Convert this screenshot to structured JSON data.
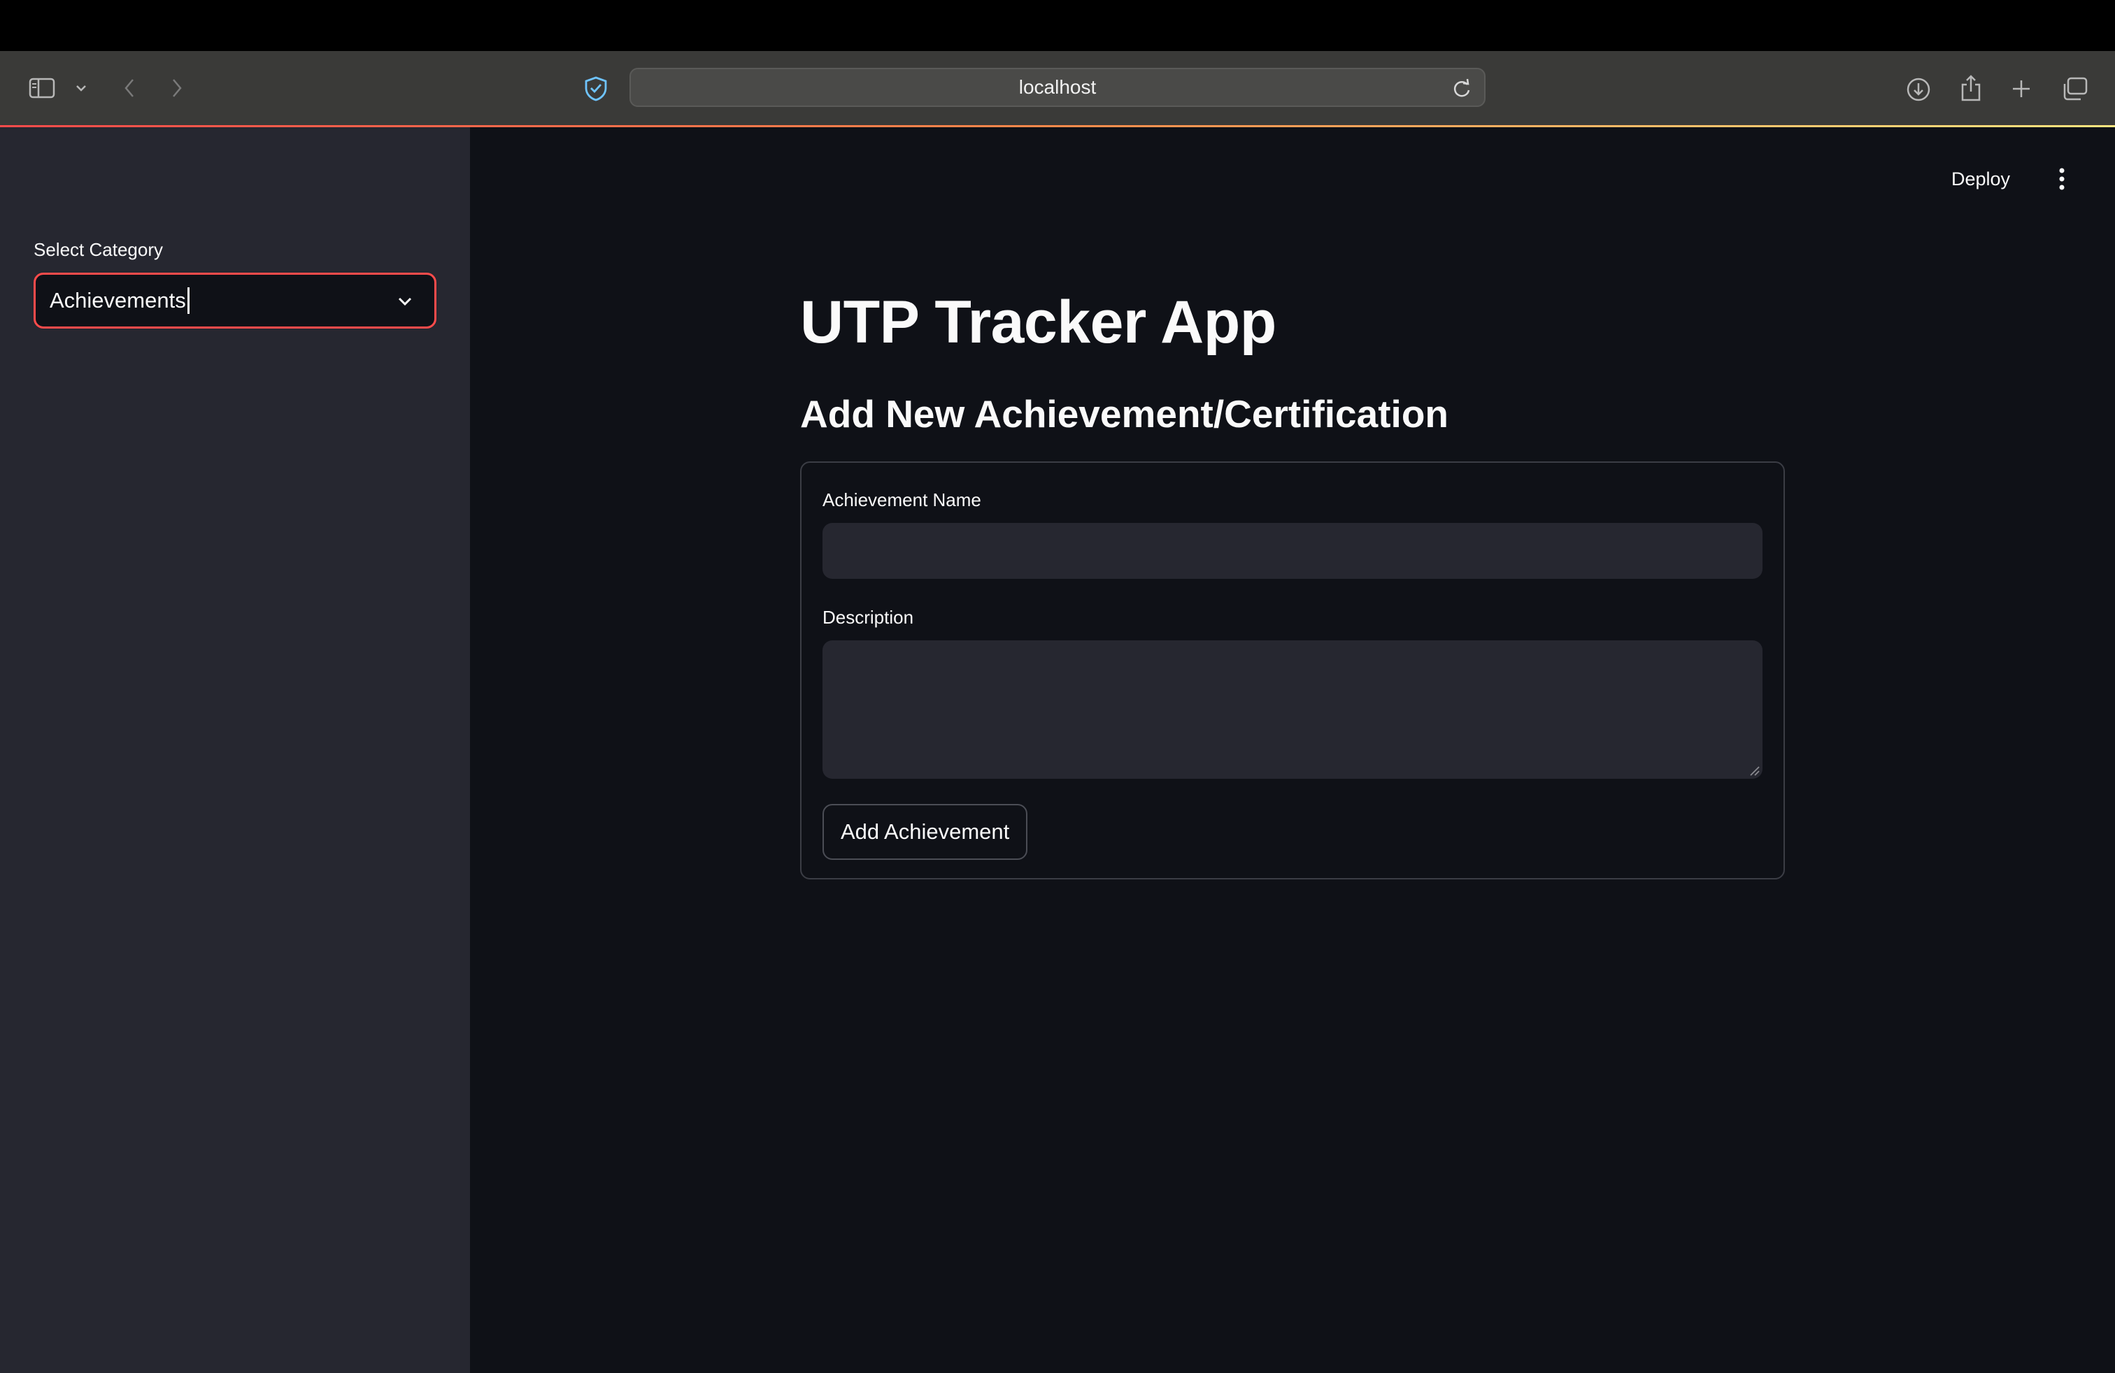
{
  "browser": {
    "url": "localhost"
  },
  "header": {
    "deploy_label": "Deploy"
  },
  "sidebar": {
    "select_label": "Select Category",
    "select_value": "Achievements"
  },
  "main": {
    "title": "UTP Tracker App",
    "subtitle": "Add New Achievement/Certification",
    "form": {
      "name_label": "Achievement Name",
      "name_value": "",
      "description_label": "Description",
      "description_value": "",
      "submit_label": "Add Achievement"
    }
  },
  "colors": {
    "accent": "#ff4b4b",
    "background": "#0f1117",
    "sidebar_background": "#262730",
    "input_background": "#262730",
    "text": "#fafafa"
  },
  "icons": [
    "sidebar-toggle-icon",
    "chevron-down-icon",
    "back-arrow-icon",
    "forward-arrow-icon",
    "shield-icon",
    "reload-icon",
    "download-icon",
    "share-icon",
    "plus-icon",
    "tabs-overview-icon",
    "kebab-menu-icon",
    "select-chevron-icon"
  ]
}
